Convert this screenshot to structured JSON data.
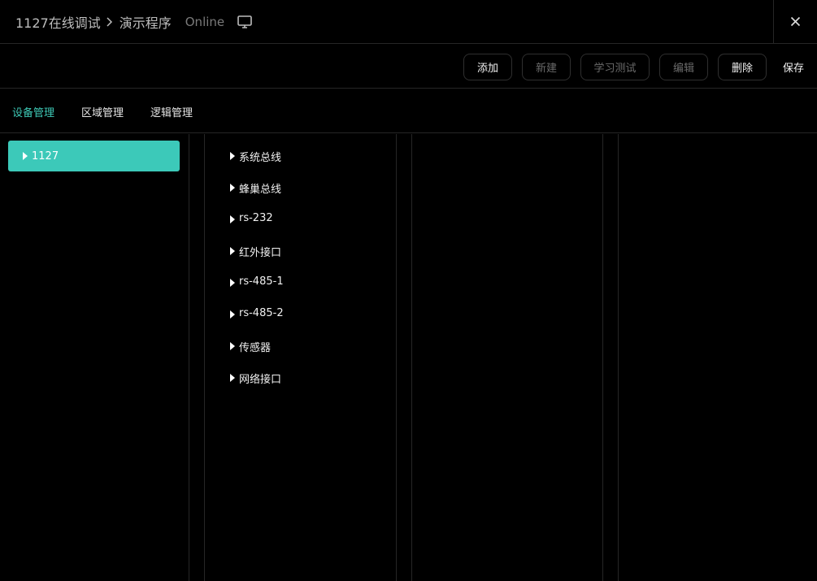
{
  "titlebar": {
    "device": "1127在线调试",
    "program": "演示程序",
    "status": "Online",
    "icons": {
      "separator": "chevron-right-icon",
      "monitor": "monitor-icon",
      "close": "close-icon"
    }
  },
  "toolbar": {
    "add": "添加",
    "new": "新建",
    "learn_test": "学习测试",
    "edit": "编辑",
    "delete": "删除",
    "save": "保存"
  },
  "tabs": [
    {
      "label": "设备管理",
      "active": true
    },
    {
      "label": "区域管理",
      "active": false
    },
    {
      "label": "逻辑管理",
      "active": false
    }
  ],
  "devices": [
    {
      "label": "1127",
      "selected": true
    }
  ],
  "ports": [
    "系统总线",
    "蜂巢总线",
    "rs-232",
    "红外接口",
    "rs-485-1",
    "rs-485-2",
    "传感器",
    "网络接口"
  ],
  "colors": {
    "accent": "#3ec9b6",
    "selected_bg": "#3cc9b9",
    "background": "#000000",
    "border": "#262626"
  }
}
